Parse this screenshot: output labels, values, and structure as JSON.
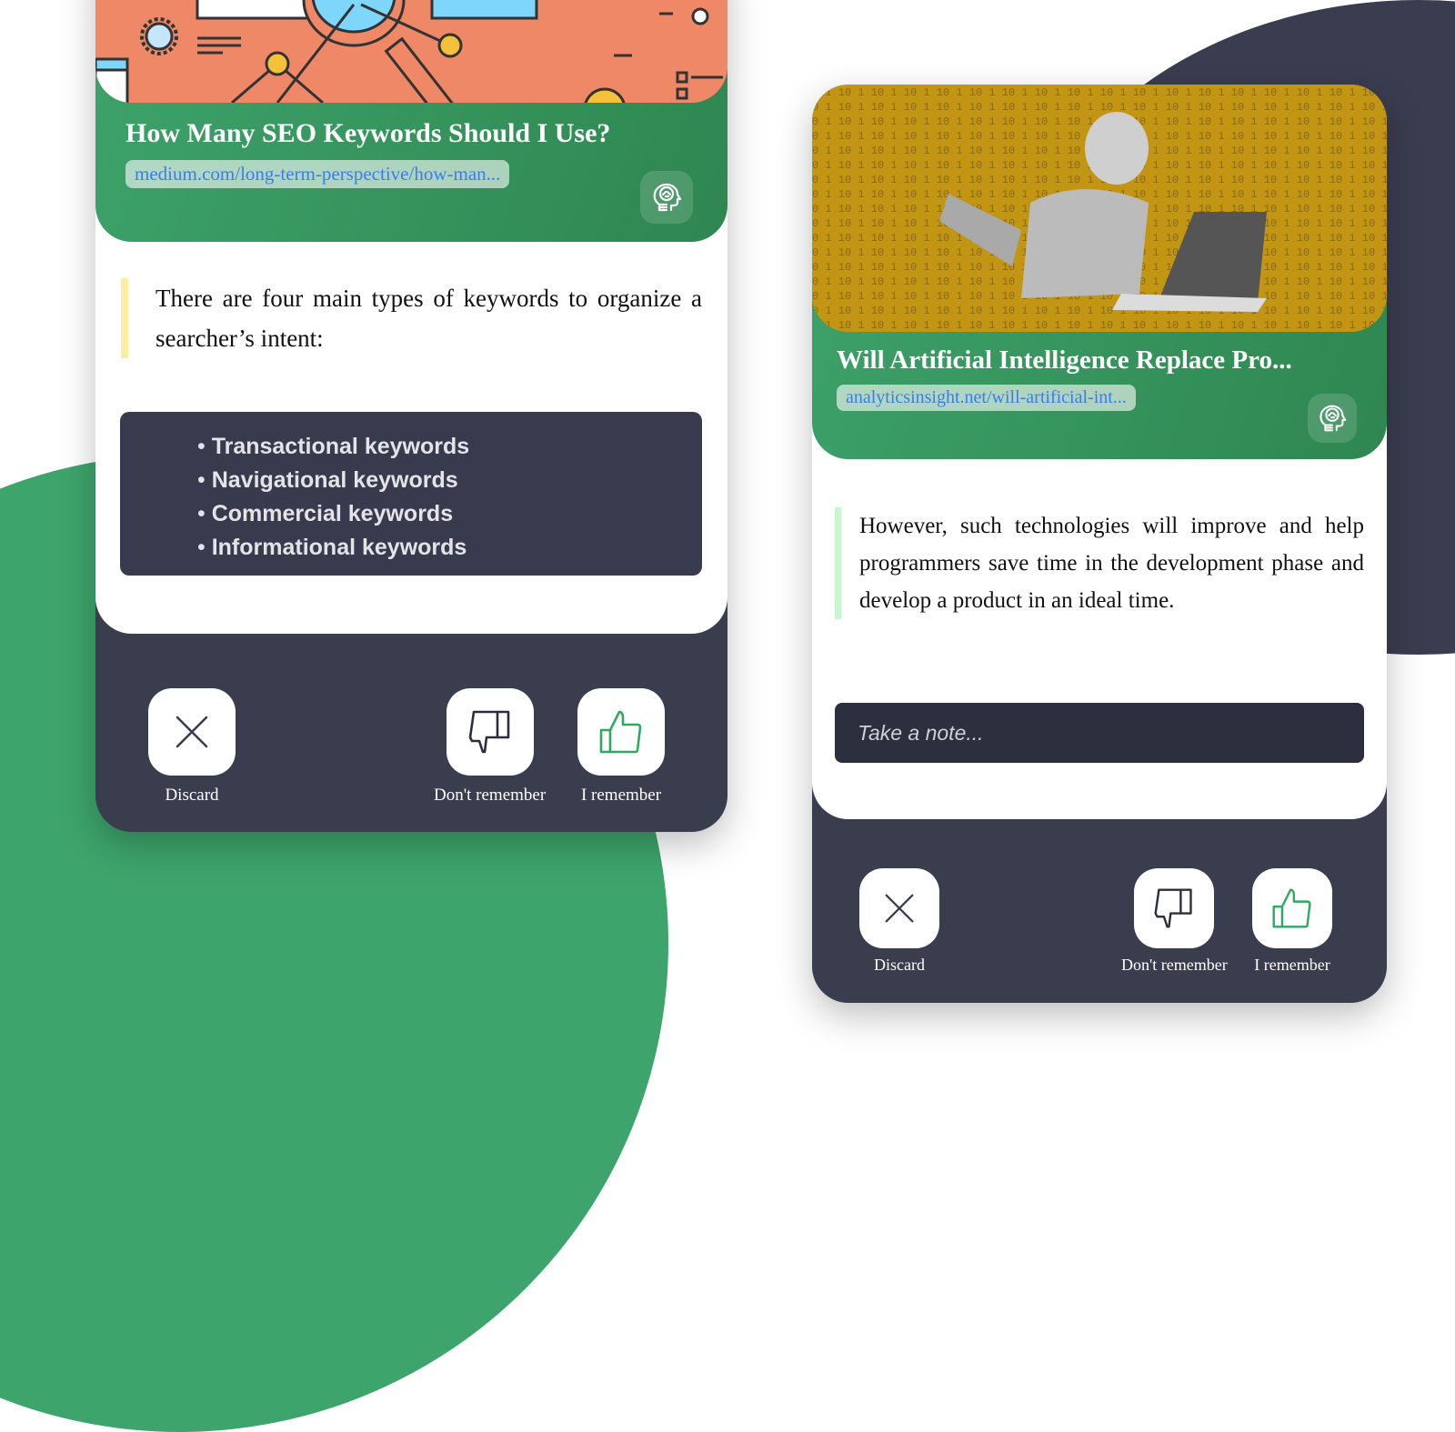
{
  "colors": {
    "brand_green": "#3da46b",
    "dark_navy": "#3a3d4e",
    "link_blue": "#3b7cf0",
    "thumbs_up_green": "#2fa862"
  },
  "cards": [
    {
      "image_alt": "SEO illustration with gear, magnifier and network nodes",
      "title": "How Many SEO Keywords Should I Use?",
      "link": "medium.com/long-term-perspective/how-man...",
      "brain_icon": "brain-head-icon",
      "quote": "There are four main types of keywords to organize a searcher’s intent:",
      "keywords": [
        "Transactional keywords",
        "Navigational keywords",
        "Commercial keywords",
        "Informational keywords"
      ],
      "actions": {
        "discard": "Discard",
        "dont_remember": "Don't remember",
        "remember": "I remember"
      }
    },
    {
      "image_alt": "Robot lying down using a laptop on binary code background",
      "title": "Will Artificial Intelligence Replace Pro...",
      "link": "analyticsinsight.net/will-artificial-int...",
      "brain_icon": "brain-head-icon",
      "quote": "However, such technologies will improve and help programmers save time in the development phase and develop a product in an ideal time.",
      "note_placeholder": "Take a note...",
      "actions": {
        "discard": "Discard",
        "dont_remember": "Don't remember",
        "remember": "I remember"
      }
    }
  ]
}
